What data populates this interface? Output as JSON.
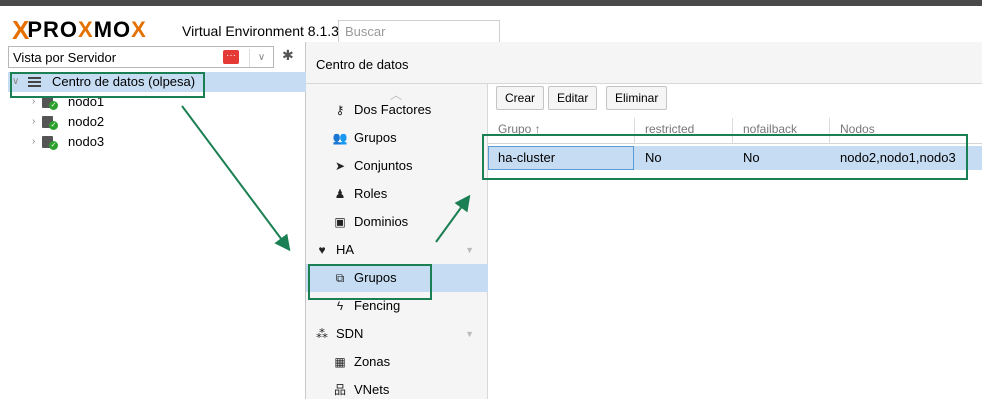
{
  "app": {
    "logo_x": "X",
    "logo_word_a": "PRO",
    "logo_word_b": "X",
    "logo_word_c": "MO",
    "logo_word_d": "X",
    "version": "Virtual Environment 8.1.3",
    "search_placeholder": "Buscar",
    "accent_color": "#e57000"
  },
  "left": {
    "view_selector": "Vista por Servidor",
    "tree": {
      "datacenter": "Centro de datos (olpesa)",
      "nodes": [
        "nodo1",
        "nodo2",
        "nodo3"
      ]
    }
  },
  "center": {
    "title": "Centro de datos"
  },
  "nav": {
    "items": [
      {
        "label": "Dos Factores",
        "icon": "key-icon"
      },
      {
        "label": "Grupos",
        "icon": "users-icon"
      },
      {
        "label": "Conjuntos",
        "icon": "tags-icon"
      },
      {
        "label": "Roles",
        "icon": "male-icon"
      },
      {
        "label": "Dominios",
        "icon": "address-book-icon"
      },
      {
        "label": "HA",
        "icon": "heartbeat-icon"
      },
      {
        "label": "Grupos",
        "icon": "object-group-icon"
      },
      {
        "label": "Fencing",
        "icon": "bolt-icon"
      },
      {
        "label": "SDN",
        "icon": "sdn-icon"
      },
      {
        "label": "Zonas",
        "icon": "th-icon"
      },
      {
        "label": "VNets",
        "icon": "sitemap-icon"
      }
    ]
  },
  "toolbar": {
    "create": "Crear",
    "edit": "Editar",
    "delete": "Eliminar"
  },
  "grid": {
    "columns": [
      "Grupo ↑",
      "restricted",
      "nofailback",
      "Nodos"
    ],
    "rows": [
      {
        "grupo": "ha-cluster",
        "restricted": "No",
        "nofailback": "No",
        "nodos": "nodo2,nodo1,nodo3"
      }
    ]
  },
  "colors": {
    "selection": "#c5dcf2",
    "annotation": "#1a7f52"
  }
}
